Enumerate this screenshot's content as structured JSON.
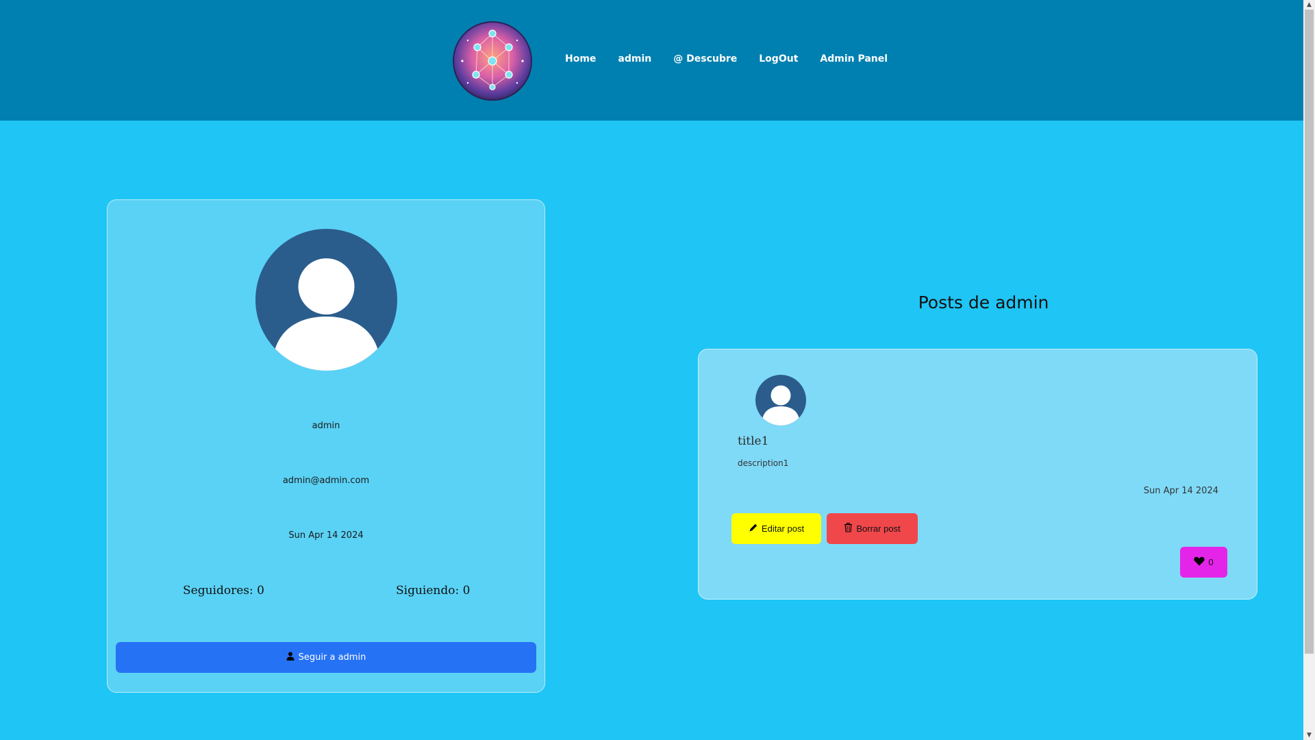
{
  "header": {
    "nav": [
      {
        "label": "Home"
      },
      {
        "label": "admin"
      },
      {
        "label": "@ Descubre"
      },
      {
        "label": "LogOut"
      },
      {
        "label": "Admin Panel"
      }
    ],
    "logo_icon": "network-globe-icon"
  },
  "profile": {
    "avatar_icon": "user-avatar-icon",
    "username": "admin",
    "email": "admin@admin.com",
    "joined": "Sun Apr 14 2024",
    "followers_label": "Seguidores: 0",
    "following_label": "Siguiendo: 0",
    "follow_button": "Seguir a admin"
  },
  "posts": {
    "heading": "Posts de admin",
    "items": [
      {
        "title": "title1",
        "description": "description1",
        "date": "Sun Apr 14 2024",
        "edit_label": "Editar post",
        "delete_label": "Borrar post",
        "likes": "0"
      }
    ]
  },
  "colors": {
    "header_bg": "#0080b0",
    "page_bg": "#1fc5f5",
    "follow_btn": "#2672f5",
    "edit_btn": "#ffff00",
    "delete_btn": "#f0474b",
    "like_btn": "#e524e9"
  }
}
